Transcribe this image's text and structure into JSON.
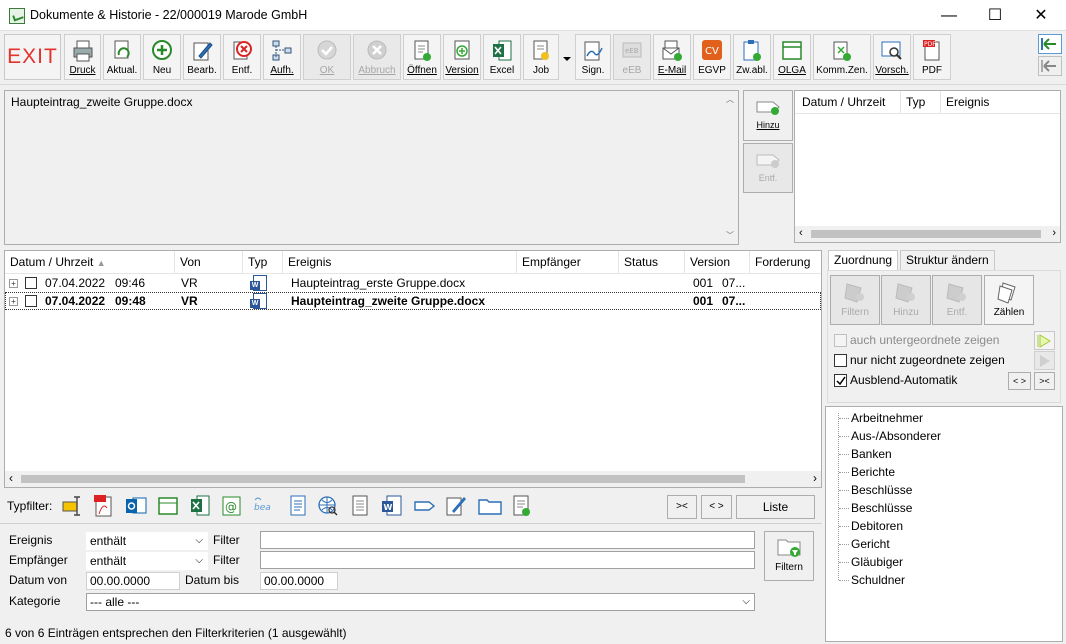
{
  "window": {
    "title": "Dokumente & Historie - 22/000019 Marode GmbH",
    "minimize": "—",
    "maximize": "☐",
    "close": "✕"
  },
  "toolbar": {
    "exit": "EXIT",
    "buttons": [
      {
        "label": "Druck",
        "icon": "printer-icon"
      },
      {
        "label": "Aktual.",
        "icon": "refresh-icon"
      },
      {
        "label": "Neu",
        "icon": "plus-icon"
      },
      {
        "label": "Bearb.",
        "icon": "edit-icon"
      },
      {
        "label": "Entf.",
        "icon": "delete-icon"
      },
      {
        "label": "Aufh.",
        "icon": "hierarchy-icon"
      },
      {
        "label": "OK",
        "icon": "ok-icon"
      },
      {
        "label": "Abbruch",
        "icon": "cancel-icon"
      },
      {
        "label": "Öffnen",
        "icon": "open-doc-icon"
      },
      {
        "label": "Version",
        "icon": "version-icon"
      },
      {
        "label": "Excel",
        "icon": "excel-icon"
      },
      {
        "label": "Job",
        "icon": "job-icon"
      },
      {
        "label": "Sign.",
        "icon": "sign-icon"
      },
      {
        "label": "eEB",
        "icon": "eeb-icon"
      },
      {
        "label": "E-Mail",
        "icon": "email-icon"
      },
      {
        "label": "EGVP",
        "icon": "egvp-icon"
      },
      {
        "label": "Zw.abl.",
        "icon": "clipboard-icon"
      },
      {
        "label": "OLGA",
        "icon": "olga-icon"
      },
      {
        "label": "Komm.Zen.",
        "icon": "comm-center-icon"
      },
      {
        "label": "Vorsch.",
        "icon": "preview-icon"
      },
      {
        "label": "PDF",
        "icon": "pdf-icon"
      }
    ]
  },
  "notes": {
    "text": "Haupteintrag_zweite Gruppe.docx"
  },
  "side_buttons": {
    "hinzu": "Hinzu",
    "entf": "Entf."
  },
  "history": {
    "columns": [
      "Datum / Uhrzeit",
      "Typ",
      "Ereignis"
    ]
  },
  "grid": {
    "columns": [
      "Datum / Uhrzeit",
      "Von",
      "Typ",
      "Ereignis",
      "Empfänger",
      "Status",
      "Version",
      "Forderung"
    ],
    "rows": [
      {
        "date": "07.04.2022",
        "time": "09:46",
        "von": "VR",
        "ereignis": "Haupteintrag_erste Gruppe.docx",
        "version": "001",
        "forderung": "07...",
        "selected": false
      },
      {
        "date": "07.04.2022",
        "time": "09:48",
        "von": "VR",
        "ereignis": "Haupteintrag_zweite Gruppe.docx",
        "version": "001",
        "forderung": "07...",
        "selected": true
      }
    ]
  },
  "typfilter": {
    "label": "Typfilter:",
    "btn_collapse": "><",
    "btn_expand": "< >",
    "btn_liste": "Liste"
  },
  "filter": {
    "ereignis_label": "Ereignis",
    "ereignis_mode": "enthält",
    "empfaenger_label": "Empfänger",
    "empfaenger_mode": "enthält",
    "filter_label": "Filter",
    "datum_von_label": "Datum von",
    "datum_von": "00.00.0000",
    "datum_bis_label": "Datum bis",
    "datum_bis": "00.00.0000",
    "kategorie_label": "Kategorie",
    "kategorie": "--- alle ---",
    "filtern_button": "Filtern"
  },
  "status": {
    "text": "6 von 6 Einträgen entsprechen den Filterkriterien (1 ausgewählt)"
  },
  "right": {
    "tabs": [
      "Zuordnung",
      "Struktur ändern"
    ],
    "buttons": [
      "Filtern",
      "Hinzu",
      "Entf.",
      "Zählen"
    ],
    "checkboxes": [
      {
        "label": "auch untergeordnete zeigen",
        "checked": false,
        "disabled": true
      },
      {
        "label": "nur nicht zugeordnete zeigen",
        "checked": false,
        "disabled": false
      },
      {
        "label": "Ausblend-Automatik",
        "checked": true,
        "disabled": false
      }
    ],
    "btn_expand": "< >",
    "btn_collapse": "><",
    "tree": [
      "Arbeitnehmer",
      "Aus-/Absonderer",
      "Banken",
      "Berichte",
      "Beschlüsse",
      "Beschlüsse",
      "Debitoren",
      "Gericht",
      "Gläubiger",
      "Schuldner"
    ]
  }
}
